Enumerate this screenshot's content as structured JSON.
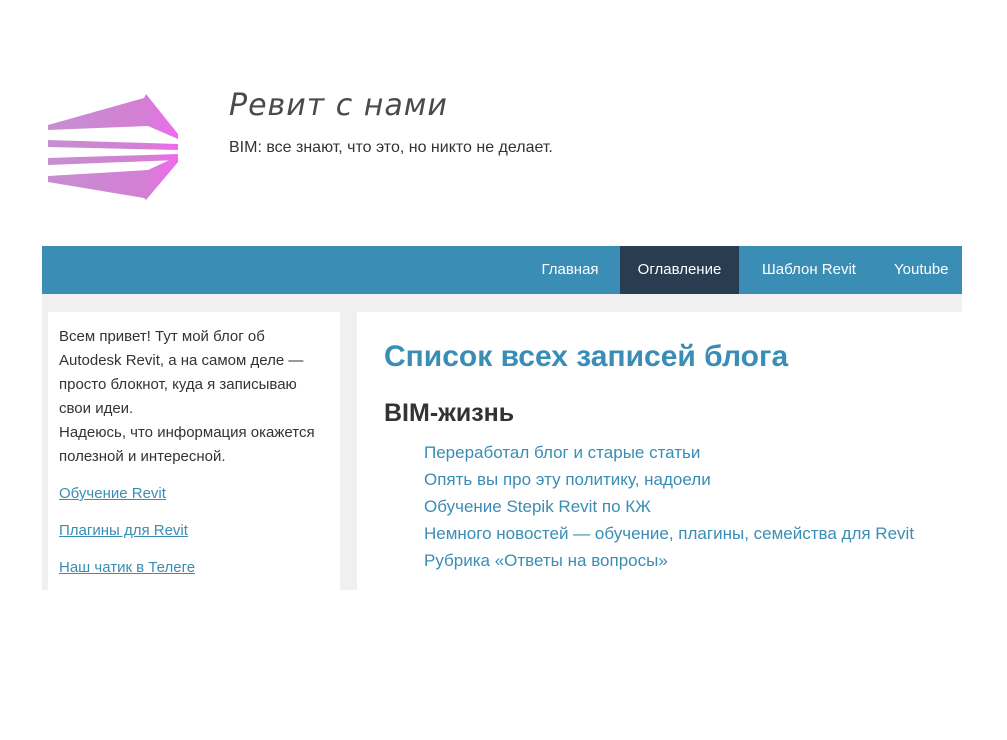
{
  "header": {
    "site_title": "Ревит с нами",
    "tagline": "BIM: все знают, что это, но никто не делает."
  },
  "colors": {
    "accent": "#3a8db5",
    "nav_active": "#2a3c4f",
    "logo_pink": "#e05ae0"
  },
  "nav": {
    "items": [
      {
        "label": "Главная"
      },
      {
        "label": "Оглавление"
      },
      {
        "label": "Шаблон Revit"
      },
      {
        "label": "Youtube"
      }
    ],
    "active": "Оглавление"
  },
  "sidebar": {
    "intro": "Всем привет! Тут мой блог об Autodesk Revit, а на самом деле — просто блокнот, куда я записываю свои идеи.",
    "intro2": "Надеюсь, что информация окажется полезной и интересной.",
    "links": [
      {
        "label": "Обучение Revit"
      },
      {
        "label": "Плагины для Revit"
      },
      {
        "label": "Наш чатик в Телеге"
      }
    ]
  },
  "main": {
    "title": "Список всех записей блога",
    "section": "BIM-жизнь",
    "posts": [
      {
        "label": "Переработал блог и старые статьи"
      },
      {
        "label": "Опять вы про эту политику, надоели"
      },
      {
        "label": "Обучение Stepik Revit по КЖ"
      },
      {
        "label": "Немного новостей — обучение, плагины, семейства для Revit"
      },
      {
        "label": "Рубрика «Ответы на вопросы»"
      }
    ]
  }
}
